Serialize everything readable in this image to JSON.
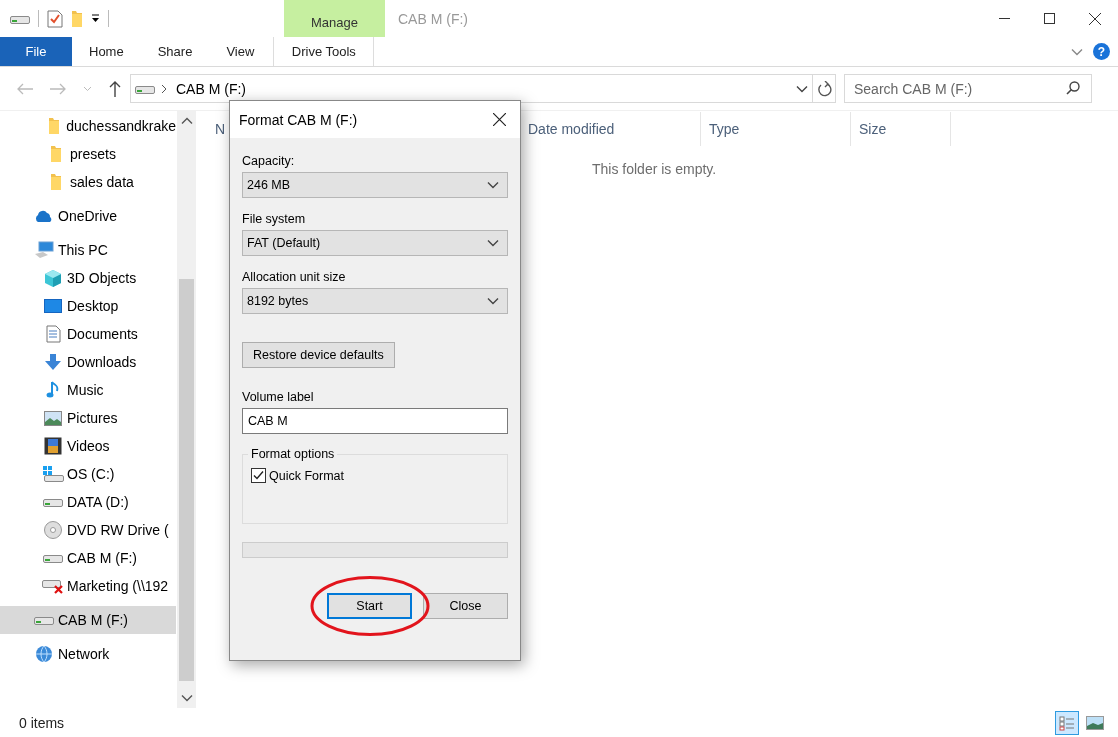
{
  "window": {
    "title": "CAB M (F:)",
    "contextual_group": "Manage"
  },
  "ribbon": {
    "tabs": [
      {
        "label": "File",
        "kind": "file",
        "selected": false
      },
      {
        "label": "Home",
        "kind": "plain",
        "selected": false
      },
      {
        "label": "Share",
        "kind": "plain",
        "selected": false
      },
      {
        "label": "View",
        "kind": "plain",
        "selected": false
      },
      {
        "label": "Drive Tools",
        "kind": "contextual",
        "selected": false
      }
    ],
    "help": "?"
  },
  "address_bar": {
    "location": "CAB M (F:)"
  },
  "search": {
    "placeholder": "Search CAB M (F:)"
  },
  "sidebar": {
    "pinned_folders": [
      {
        "label": "duchessandkrake",
        "kind": "folder",
        "selected": false
      },
      {
        "label": "presets",
        "kind": "folder",
        "selected": false
      },
      {
        "label": "sales data",
        "kind": "folder",
        "selected": false
      }
    ],
    "items": [
      {
        "label": "OneDrive",
        "kind": "cloud",
        "selected": false
      },
      {
        "label": "This PC",
        "kind": "pc",
        "selected": false,
        "children": [
          {
            "label": "3D Objects",
            "kind": "cube",
            "selected": false
          },
          {
            "label": "Desktop",
            "kind": "desktop",
            "selected": false
          },
          {
            "label": "Documents",
            "kind": "document",
            "selected": false
          },
          {
            "label": "Downloads",
            "kind": "download",
            "selected": false
          },
          {
            "label": "Music",
            "kind": "music",
            "selected": false
          },
          {
            "label": "Pictures",
            "kind": "picture",
            "selected": false
          },
          {
            "label": "Videos",
            "kind": "video",
            "selected": false
          },
          {
            "label": "OS (C:)",
            "kind": "osdrive",
            "selected": false
          },
          {
            "label": "DATA (D:)",
            "kind": "drive",
            "selected": false
          },
          {
            "label": "DVD RW Drive (",
            "kind": "dvd",
            "selected": false
          },
          {
            "label": "CAB M (F:)",
            "kind": "drive",
            "selected": false
          },
          {
            "label": "Marketing (\\\\192",
            "kind": "netdrive",
            "selected": false
          }
        ]
      },
      {
        "label": "CAB M (F:)",
        "kind": "drive",
        "selected": true
      },
      {
        "label": "Network",
        "kind": "network",
        "selected": false
      }
    ]
  },
  "columns": [
    {
      "label": "N"
    },
    {
      "label": "Date modified"
    },
    {
      "label": "Type"
    },
    {
      "label": "Size"
    }
  ],
  "empty_message": "This folder is empty.",
  "status_bar": {
    "item_count": "0 items",
    "views": [
      {
        "kind": "details",
        "selected": true
      },
      {
        "kind": "large-icons",
        "selected": false
      }
    ]
  },
  "dialog": {
    "title": "Format CAB M (F:)",
    "fields": [
      {
        "kind": "combo",
        "label": "Capacity:",
        "value": "246 MB"
      },
      {
        "kind": "combo",
        "label": "File system",
        "value": "FAT (Default)"
      },
      {
        "kind": "combo",
        "label": "Allocation unit size",
        "value": "8192 bytes"
      },
      {
        "kind": "button",
        "label": "Restore device defaults"
      },
      {
        "kind": "text",
        "label": "Volume label",
        "value": "CAB M"
      }
    ],
    "format_options": {
      "title": "Format options",
      "options": [
        {
          "label": "Quick Format",
          "checked": true
        }
      ]
    },
    "progress": {
      "level": 0
    },
    "buttons": [
      {
        "label": "Start",
        "default": true
      },
      {
        "label": "Close",
        "default": false
      }
    ]
  }
}
